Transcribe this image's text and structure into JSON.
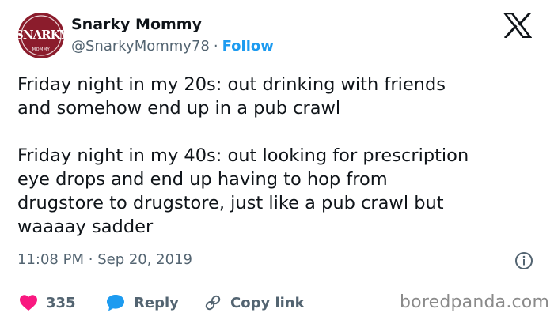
{
  "author": {
    "display_name": "Snarky Mommy",
    "handle": "@SnarkyMommy78",
    "separator": "·",
    "follow_label": "Follow",
    "avatar_text": "SNARKY",
    "avatar_subtext": "MOMMY",
    "avatar_color": "#8b1c2c"
  },
  "tweet": {
    "paragraph_1": "Friday night in my 20s: out drinking with friends\nand somehow end up in a pub crawl",
    "paragraph_2": "Friday night in my 40s: out looking for prescription\neye drops and end up having to hop from\ndrugstore to drugstore, just like a pub crawl but\nwaaaay sadder"
  },
  "meta": {
    "time": "11:08 PM",
    "separator": "·",
    "date": "Sep 20, 2019"
  },
  "actions": {
    "likes_count": "335",
    "reply_label": "Reply",
    "copy_label": "Copy link"
  },
  "watermark": "boredpanda.com",
  "icons": {
    "brand": "x-logo-icon",
    "info": "info-icon",
    "like": "heart-icon",
    "reply": "reply-bubble-icon",
    "copy": "link-icon"
  },
  "colors": {
    "like": "#f91880",
    "reply": "#1d9bf0",
    "link": "#1d9bf0",
    "secondary_text": "#536471",
    "divider": "#cfd9de"
  }
}
